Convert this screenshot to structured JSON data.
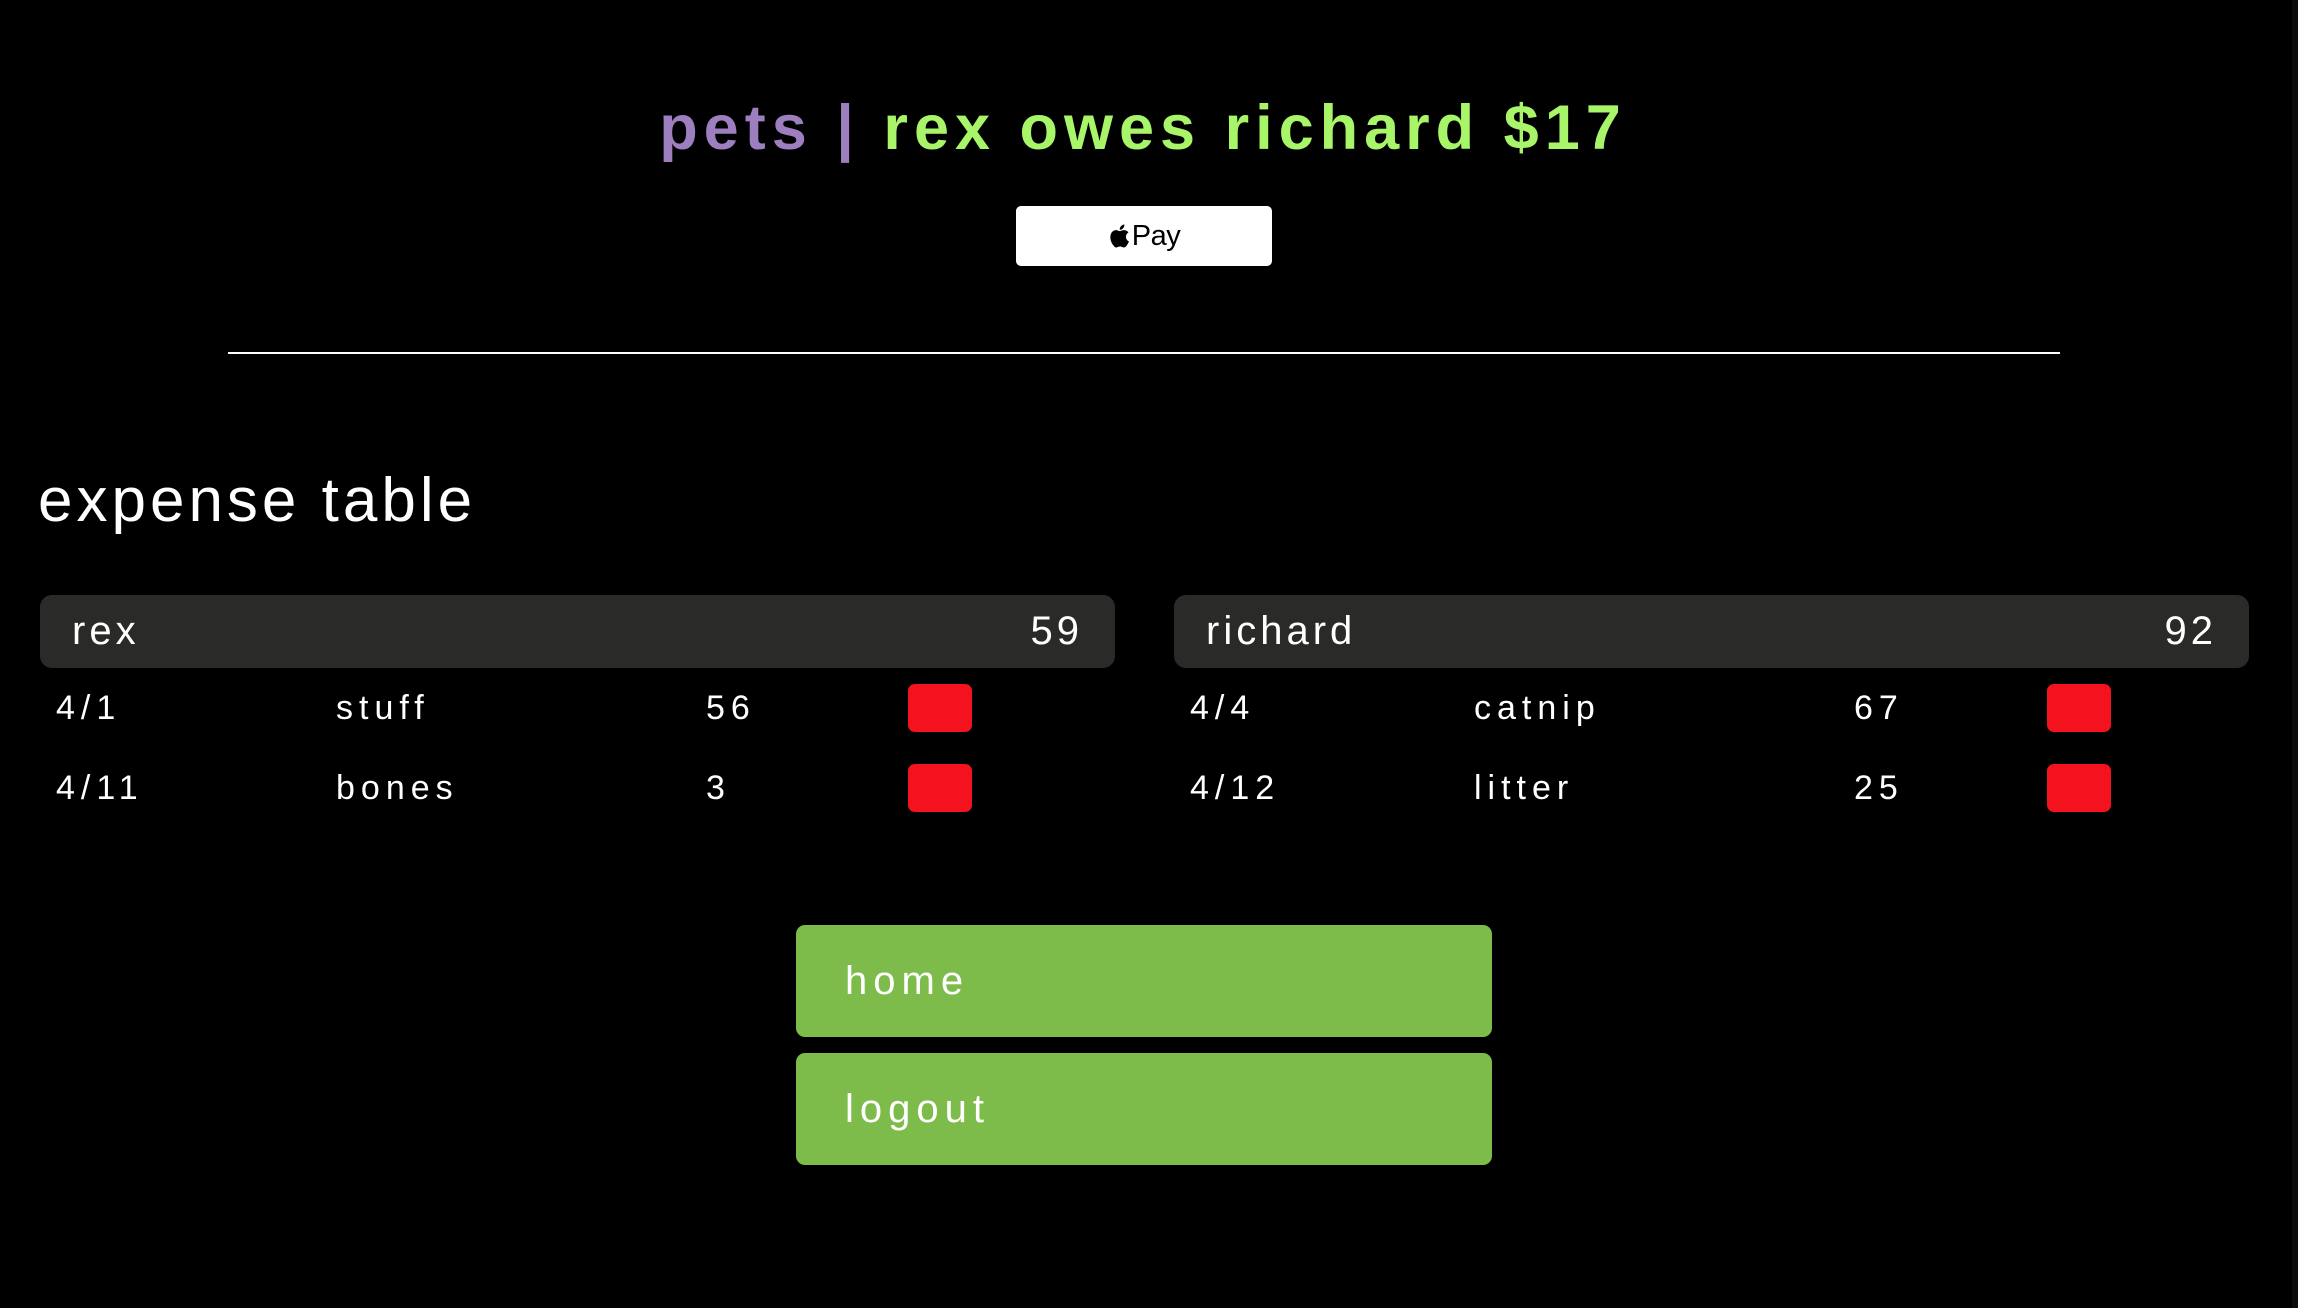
{
  "header": {
    "group_name": "pets",
    "separator": "|",
    "owe_summary": "rex owes richard $17"
  },
  "apple_pay": {
    "label": "Pay",
    "icon": "apple-icon"
  },
  "section": {
    "title": "expense table"
  },
  "people": [
    {
      "name": "rex",
      "total": "59",
      "expenses": [
        {
          "date": "4/1",
          "item": "stuff",
          "amount": "56"
        },
        {
          "date": "4/11",
          "item": "bones",
          "amount": "3"
        }
      ]
    },
    {
      "name": "richard",
      "total": "92",
      "expenses": [
        {
          "date": "4/4",
          "item": "catnip",
          "amount": "67"
        },
        {
          "date": "4/12",
          "item": "litter",
          "amount": "25"
        }
      ]
    }
  ],
  "nav": {
    "home_label": "home",
    "logout_label": "logout"
  },
  "colors": {
    "group_color": "#9d7fbf",
    "owe_color": "#a9f56a",
    "delete_button": "#f5121f",
    "nav_button": "#7dbb4a",
    "header_bg": "#2a2a28"
  }
}
